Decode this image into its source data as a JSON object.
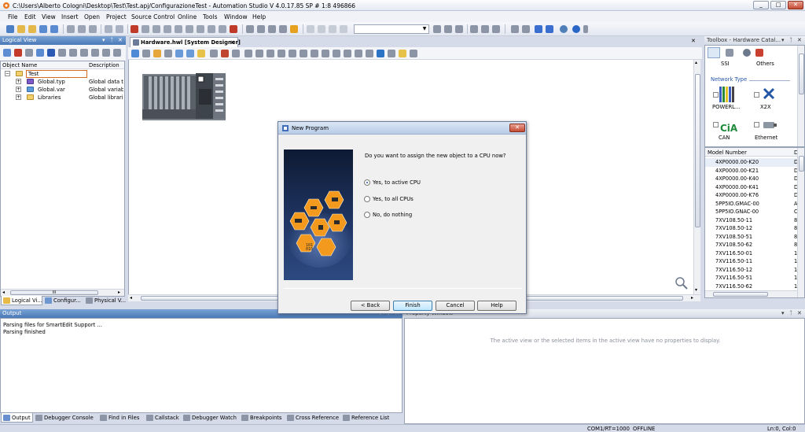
{
  "window": {
    "title": "C:\\Users\\Alberto Cologni\\Desktop\\Test\\Test.apj/ConfigurazioneTest - Automation Studio V 4.0.17.85 SP # 1:8 496866",
    "minimize": "_",
    "maximize": "□",
    "close": "✕"
  },
  "menu": [
    "File",
    "Edit",
    "View",
    "Insert",
    "Open",
    "Project",
    "Source Control",
    "Online",
    "Tools",
    "Window",
    "Help"
  ],
  "logical_view": {
    "title": "Logical View",
    "col_name": "Object Name",
    "col_desc": "Description",
    "rows": [
      {
        "name": "Test",
        "desc": ""
      },
      {
        "name": "Global.typ",
        "desc": "Global data typ"
      },
      {
        "name": "Global.var",
        "desc": "Global variable"
      },
      {
        "name": "Libraries",
        "desc": "Global libraries"
      }
    ],
    "scroll_mark": "III",
    "tabs": [
      "Logical Vi...",
      "Configur...",
      "Physical V..."
    ]
  },
  "editor": {
    "tab_label": "Hardware.hwl [System Designer]",
    "tab_close": "✕",
    "zoom_icon": "magnifier"
  },
  "toolbox": {
    "title": "Toolbox - Hardware Catal...",
    "categories": [
      "SSI",
      "Others"
    ],
    "section": "Network Type",
    "network_types": [
      "POWERL...",
      "X2X",
      "CAN",
      "Ethernet"
    ],
    "list_header": "Model Number",
    "list_header2": "D",
    "models": [
      {
        "name": "4XP0000.00-K20",
        "d": "D"
      },
      {
        "name": "4XP0000.00-K21",
        "d": "D"
      },
      {
        "name": "4XP0000.00-K40",
        "d": "D"
      },
      {
        "name": "4XP0000.00-K41",
        "d": "D"
      },
      {
        "name": "4XP0000.00-K76",
        "d": "D"
      },
      {
        "name": "5PP5IO.GMAC-00",
        "d": "A"
      },
      {
        "name": "5PP5IO.GNAC-00",
        "d": "C"
      },
      {
        "name": "7XV108.50-11",
        "d": "8"
      },
      {
        "name": "7XV108.50-12",
        "d": "8"
      },
      {
        "name": "7XV108.50-51",
        "d": "8"
      },
      {
        "name": "7XV108.50-62",
        "d": "8"
      },
      {
        "name": "7XV116.50-01",
        "d": "1"
      },
      {
        "name": "7XV116.50-11",
        "d": "1"
      },
      {
        "name": "7XV116.50-12",
        "d": "1"
      },
      {
        "name": "7XV116.50-51",
        "d": "1"
      },
      {
        "name": "7XV116.50-62",
        "d": "1"
      }
    ]
  },
  "output": {
    "title": "Output",
    "lines": [
      "Parsing files for SmartEdit Support ...",
      "Parsing finished"
    ],
    "tabs": [
      "Output",
      "Debugger Console",
      "Find in Files",
      "Callstack",
      "Debugger Watch",
      "Breakpoints",
      "Cross Reference",
      "Reference List"
    ]
  },
  "properties": {
    "title": "Property Window",
    "empty_message": "The active view or the selected items in the active view have no properties to display."
  },
  "dialog": {
    "title": "New Program",
    "question": "Do you want to assign the new object to a CPU now?",
    "options": [
      "Yes, to active CPU",
      "Yes, to all CPUs",
      "No, do nothing"
    ],
    "selected": 0,
    "buttons": {
      "back": "< Back",
      "finish": "Finish",
      "cancel": "Cancel",
      "help": "Help"
    },
    "image_text": [
      "101",
      "010"
    ]
  },
  "statusbar": {
    "port": "COM1/RT=1000",
    "mode": "OFFLINE",
    "position": "Ln:0, Col:0"
  },
  "colors": {
    "accent_blue": "#4a79b8",
    "orange": "#f39a1e",
    "dialog_bg": "#f0f0f0"
  }
}
